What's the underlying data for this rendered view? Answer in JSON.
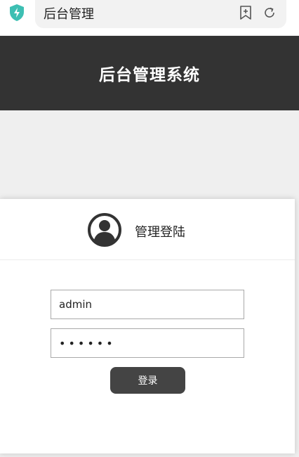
{
  "browser": {
    "title": "后台管理",
    "icons": [
      "shield-icon",
      "bookmark-add-icon",
      "refresh-icon"
    ],
    "accent": "#3dbfb3"
  },
  "header": {
    "title": "后台管理系统",
    "background": "#333333"
  },
  "login": {
    "title": "管理登陆",
    "avatar_icon": "user-avatar-icon",
    "username_value": "admin",
    "password_value": "••••••",
    "submit_label": "登录",
    "button_color": "#444444"
  }
}
